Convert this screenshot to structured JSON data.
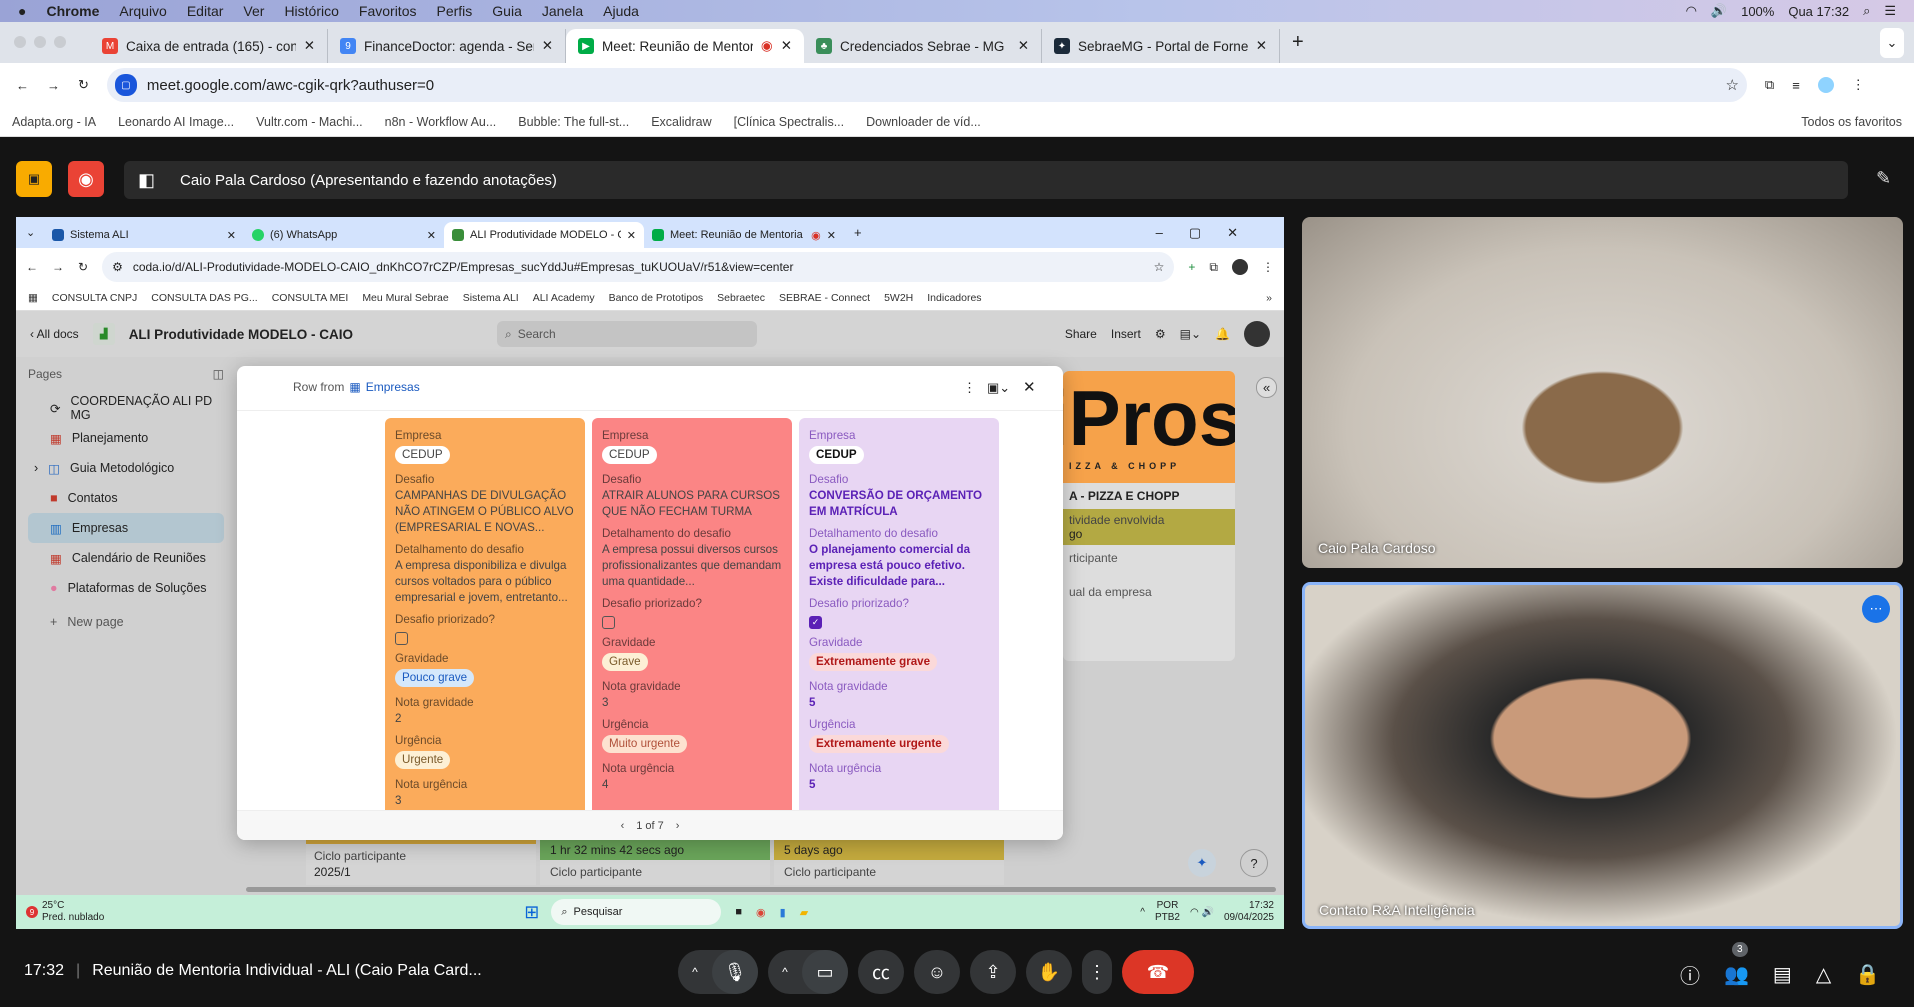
{
  "menubar": {
    "app": "Chrome",
    "items": [
      "Arquivo",
      "Editar",
      "Ver",
      "Histórico",
      "Favoritos",
      "Perfis",
      "Guia",
      "Janela",
      "Ajuda"
    ],
    "battery": "100%",
    "clock": "Qua 17:32"
  },
  "tabs": [
    {
      "label": "Caixa de entrada (165) - cont",
      "icon": "gmail-icon"
    },
    {
      "label": "FinanceDoctor: agenda - Sem",
      "icon": "calendar-icon"
    },
    {
      "label": "Meet: Reunião de Mentori",
      "icon": "meet-icon",
      "active": true
    },
    {
      "label": "Credenciados Sebrae - MG",
      "icon": "sebrae-icon"
    },
    {
      "label": "SebraeMG - Portal de Fornec",
      "icon": "portal-icon"
    }
  ],
  "url": "meet.google.com/awc-cgik-qrk?authuser=0",
  "bookmarks": [
    "Adapta.org - IA",
    "Leonardo AI Image...",
    "Vultr.com - Machi...",
    "n8n - Workflow Au...",
    "Bubble: The full-st...",
    "Excalidraw",
    "[Clínica Spectralis...",
    "Downloader de víd..."
  ],
  "all_bookmarks": "Todos os favoritos",
  "presenter": "Caio Pala Cardoso (Apresentando e fazendo anotações)",
  "inner": {
    "tabs": [
      "Sistema ALI",
      "(6) WhatsApp",
      "ALI Produtividade MODELO - C",
      "Meet: Reunião de Mentoria"
    ],
    "url": "coda.io/d/ALI-Produtividade-MODELO-CAIO_dnKhCO7rCZP/Empresas_sucYddJu#Empresas_tuKUOUaV/r51&view=center",
    "bookmarks": [
      "CONSULTA CNPJ",
      "CONSULTA DAS PG...",
      "CONSULTA MEI",
      "Meu Mural Sebrae",
      "Sistema ALI",
      "ALI Academy",
      "Banco de Prototipos",
      "Sebraetec",
      "SEBRAE - Connect",
      "5W2H",
      "Indicadores"
    ],
    "coda": {
      "all_docs": "‹ All docs",
      "doc_title": "ALI Produtividade MODELO - CAIO",
      "search": "Search",
      "share": "Share",
      "insert": "Insert"
    },
    "sidebar": {
      "title": "Pages",
      "items": [
        "COORDENAÇÃO ALI PD MG",
        "Planejamento",
        "Guia Metodológico",
        "Contatos",
        "Empresas",
        "Calendário de Reuniões",
        "Plataformas de Soluções"
      ],
      "new_page": "New page"
    },
    "modal": {
      "row_from": "Row from",
      "table": "Empresas",
      "pager": "1 of 7",
      "labels": {
        "empresa": "Empresa",
        "desafio": "Desafio",
        "detalhe": "Detalhamento do desafio",
        "priorizado": "Desafio priorizado?",
        "gravidade": "Gravidade",
        "nota_grav": "Nota gravidade",
        "urgencia": "Urgência",
        "nota_urg": "Nota urgência"
      },
      "cards": [
        {
          "empresa": "CEDUP",
          "desafio": "CAMPANHAS DE DIVULGAÇÃO NÃO ATINGEM O PÚBLICO ALVO (EMPRESARIAL E NOVAS...",
          "detalhe": "A empresa disponibiliza e divulga cursos voltados para o público empresarial e jovem, entretanto...",
          "priorizado": false,
          "gravidade": "Pouco grave",
          "nota_grav": "2",
          "urgencia": "Urgente",
          "nota_urg": "3",
          "color": "#fbab5b"
        },
        {
          "empresa": "CEDUP",
          "desafio": "ATRAIR ALUNOS PARA CURSOS QUE NÃO FECHAM TURMA",
          "detalhe": "A empresa possui diversos cursos profissionalizantes que demandam uma quantidade...",
          "priorizado": false,
          "gravidade": "Grave",
          "nota_grav": "3",
          "urgencia": "Muito urgente",
          "nota_urg": "4",
          "color": "#fb8585"
        },
        {
          "empresa": "CEDUP",
          "desafio": "CONVERSÃO DE ORÇAMENTO EM MATRÍCULA",
          "detalhe": "O planejamento comercial da empresa está pouco efetivo. Existe dificuldade para...",
          "priorizado": true,
          "gravidade": "Extremamente grave",
          "nota_grav": "5",
          "urgencia": "Extremamente urgente",
          "nota_urg": "5",
          "color": "#e8d6f3"
        }
      ]
    },
    "bgcard": {
      "logo": "iProsa",
      "logo_sub": "IZZA & CHOPP",
      "name": "A - PIZZA E CHOPP",
      "f1": "tividade envolvida",
      "v1": "go",
      "f2": "rticipante",
      "f3": "ual da empresa"
    },
    "table": {
      "c1_label": "Ciclo participante",
      "c1_val": "2025/1",
      "c2_time": "1 hr 32 mins 42 secs ago",
      "c2_label": "Ciclo participante",
      "c3_time": "5 days ago",
      "c3_label": "Ciclo participante"
    },
    "taskbar": {
      "temp": "25°C",
      "weather": "Pred. nublado",
      "search": "Pesquisar",
      "lang1": "POR",
      "lang2": "PTB2",
      "time": "17:32",
      "date": "09/04/2025",
      "badge": "9"
    }
  },
  "videos": [
    {
      "name": "Caio Pala Cardoso"
    },
    {
      "name": "Contato R&A Inteligência"
    }
  ],
  "meeting": {
    "time": "17:32",
    "title": "Reunião de Mentoria Individual - ALI (Caio Pala Card...",
    "participants": "3"
  }
}
